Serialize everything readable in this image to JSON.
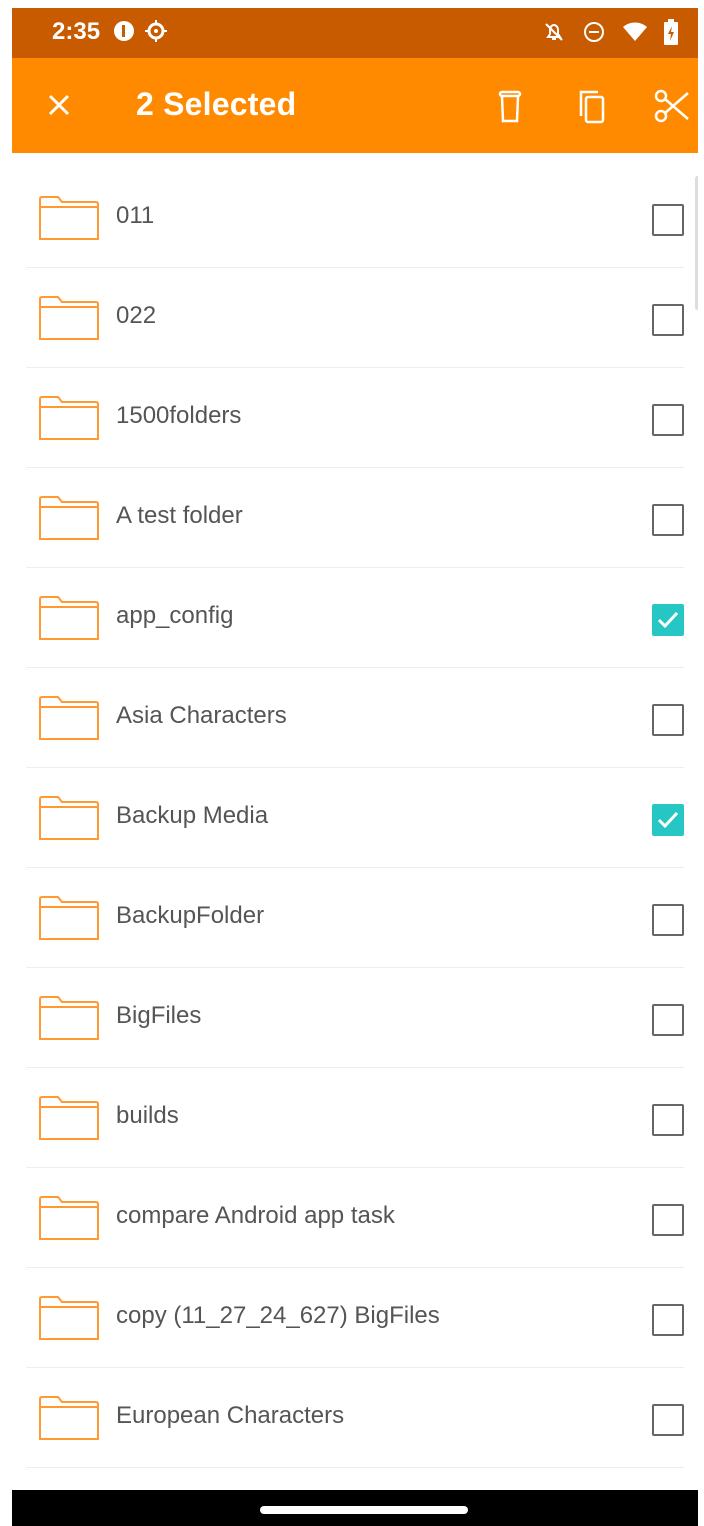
{
  "status_bar": {
    "time": "2:35",
    "left_icons": [
      "data-saver-icon",
      "settings-gear-icon"
    ],
    "right_icons": [
      "notifications-off-icon",
      "do-not-disturb-icon",
      "wifi-icon",
      "battery-charging-icon"
    ]
  },
  "app_bar": {
    "title": "2 Selected",
    "close_icon": "close-icon",
    "actions": [
      "delete-icon",
      "copy-icon",
      "cut-icon"
    ]
  },
  "folders": [
    {
      "name": "011",
      "checked": false
    },
    {
      "name": "022",
      "checked": false
    },
    {
      "name": "1500folders",
      "checked": false
    },
    {
      "name": "A test folder",
      "checked": false
    },
    {
      "name": "app_config",
      "checked": true
    },
    {
      "name": "Asia Characters",
      "checked": false
    },
    {
      "name": "Backup Media",
      "checked": true
    },
    {
      "name": "BackupFolder",
      "checked": false
    },
    {
      "name": "BigFiles",
      "checked": false
    },
    {
      "name": "builds",
      "checked": false
    },
    {
      "name": "compare Android app task",
      "checked": false
    },
    {
      "name": "copy (11_27_24_627) BigFiles",
      "checked": false
    },
    {
      "name": "European Characters",
      "checked": false
    }
  ],
  "colors": {
    "status_bar": "#C85A00",
    "app_bar": "#FF8A00",
    "folder_stroke": "#FF9A33",
    "checkbox_checked": "#26C6C4"
  }
}
